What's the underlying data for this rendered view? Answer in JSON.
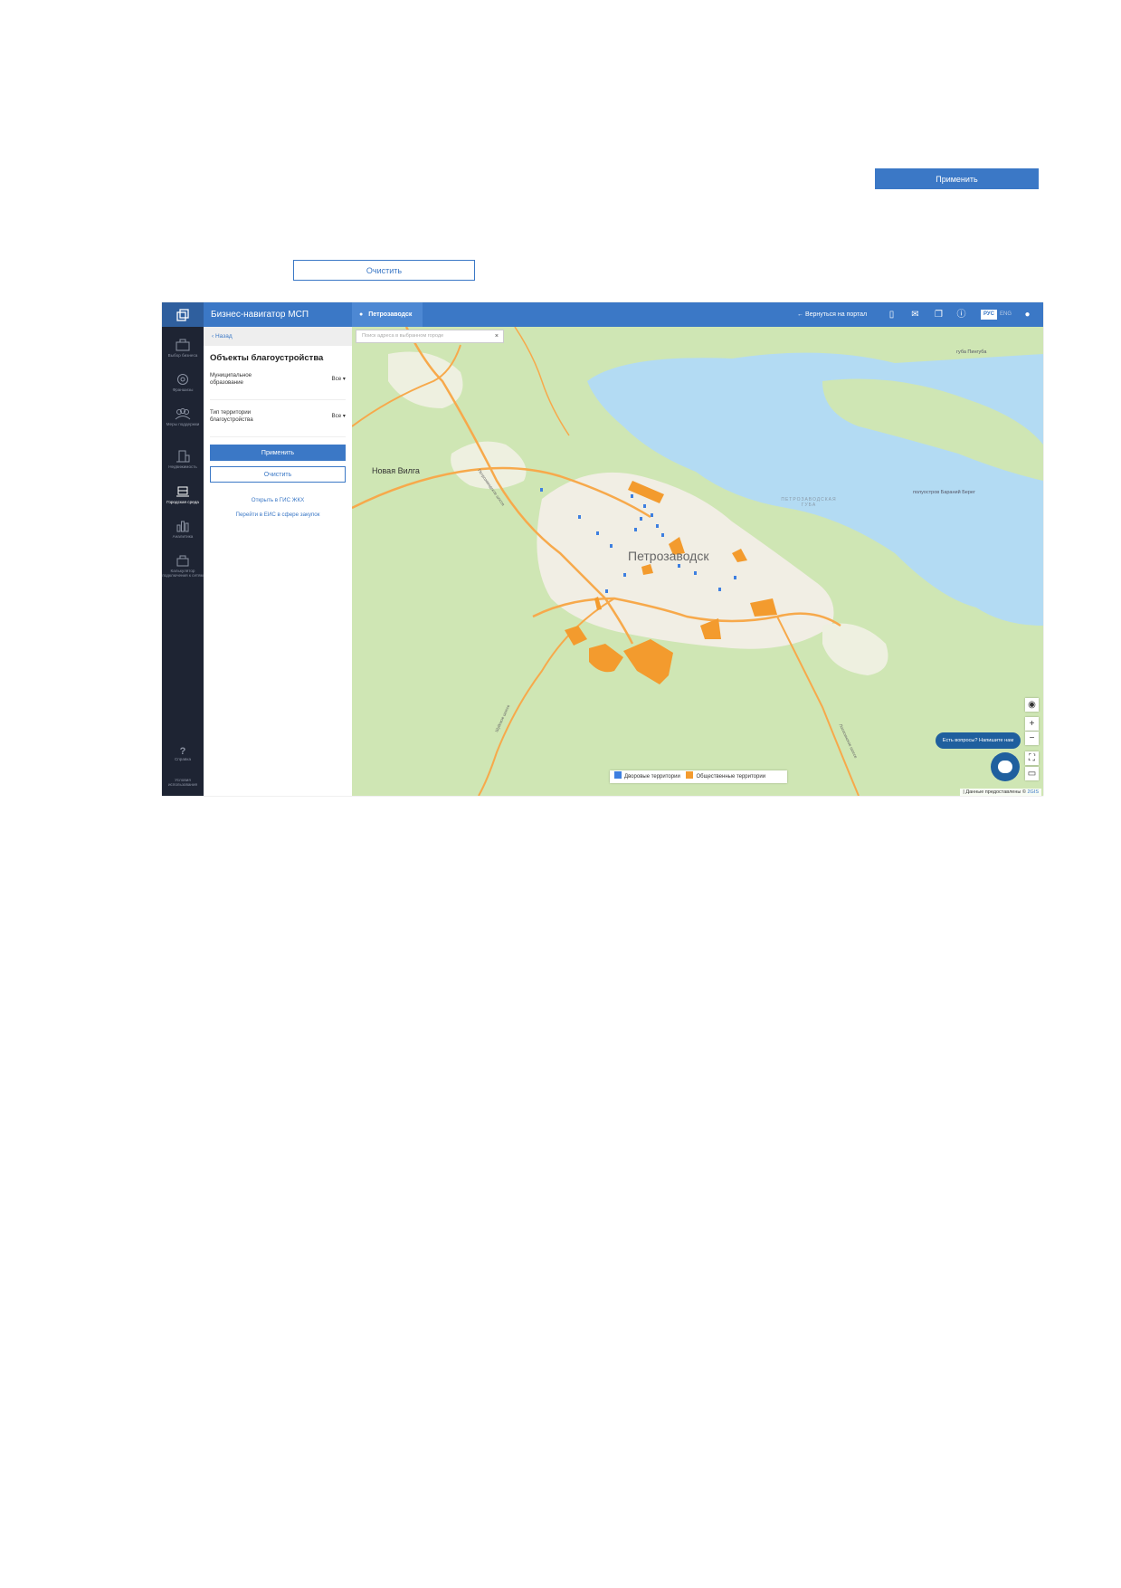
{
  "outer": {
    "apply_label": "Применить",
    "clear_label": "Очистить"
  },
  "header": {
    "app_title": "Бизнес-навигатор МСП",
    "city": "Петрозаводск",
    "back_to_portal": "Вернуться на портал",
    "lang_ru": "РУС",
    "lang_en": "ENG"
  },
  "rail": {
    "items": [
      {
        "label": "Выбор бизнеса",
        "icon": "briefcase-icon"
      },
      {
        "label": "Франшизы",
        "icon": "franchise-icon"
      },
      {
        "label": "Меры поддержки",
        "icon": "support-icon"
      },
      {
        "label": "Недвижимость",
        "icon": "building-icon"
      },
      {
        "label": "Городская среда",
        "icon": "city-environment-icon"
      },
      {
        "label": "Аналитика",
        "icon": "analytics-icon"
      },
      {
        "label": "Калькулятор подключения к сетям",
        "icon": "calculator-icon"
      }
    ],
    "help_label": "Справка",
    "terms_label": "Условия использования"
  },
  "panel": {
    "back_label": "Назад",
    "title": "Объекты благоустройства",
    "filter1_label": "Муниципальное образование",
    "filter1_value": "Все",
    "filter2_label": "Тип территории благоустройства",
    "filter2_value": "Все",
    "apply_label": "Применить",
    "clear_label": "Очистить",
    "link1": "Открыть в ГИС ЖКХ",
    "link2": "Перейти в ЕИС в сфере закупок"
  },
  "map": {
    "search_placeholder": "Поиск адреса в выбранном городе",
    "city_label": "Петрозаводск",
    "label_novaya_vilga": "Новая Вилга",
    "label_bay": "ПЕТРОЗАВОДСКАЯ ГУБА",
    "label_peninsula": "полуостров Бараний Берег",
    "label_guba_pinguba": "губа Пингуба",
    "road_label_1": "Петрозаводское шоссе",
    "road_label_2": "Шуйское шоссе",
    "road_label_3": "Лососинское шоссе",
    "legend_yard": "Дворовые территории",
    "legend_public": "Общественные территории",
    "chat_prompt": "Есть вопросы? Напишите нам",
    "attribution_prefix": "| Данные предоставлены ©",
    "attribution_brand": "2GIS"
  },
  "colors": {
    "accent": "#3b78c6",
    "yard": "#3d7fe0",
    "public": "#f39b2e",
    "water": "#b3dbf3",
    "forest": "#cfe6b4",
    "urban": "#f1eee4"
  }
}
